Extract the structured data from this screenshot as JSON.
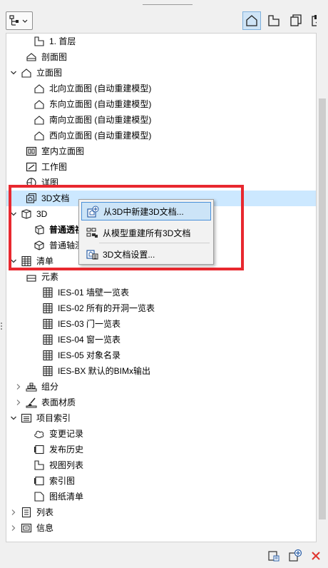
{
  "toolbar": {
    "left_icon": "project-map-icon",
    "view_icons": [
      "project-map-view-icon",
      "view-map-icon",
      "layout-book-icon",
      "publisher-sets-icon"
    ]
  },
  "tree": {
    "rows": [
      {
        "label": "1. 首层",
        "icon": "floor-plan-icon",
        "expander": "none"
      },
      {
        "label": "剖面图",
        "icon": "section-icon",
        "expander": "none"
      },
      {
        "label": "立面图",
        "icon": "elevation-icon",
        "expander": "expanded"
      },
      {
        "label": "北向立面图 (自动重建模型)",
        "icon": "elevation-icon",
        "expander": "none"
      },
      {
        "label": "东向立面图 (自动重建模型)",
        "icon": "elevation-icon",
        "expander": "none"
      },
      {
        "label": "南向立面图 (自动重建模型)",
        "icon": "elevation-icon",
        "expander": "none"
      },
      {
        "label": "西向立面图 (自动重建模型)",
        "icon": "elevation-icon",
        "expander": "none"
      },
      {
        "label": "室内立面图",
        "icon": "interior-elevation-icon",
        "expander": "none"
      },
      {
        "label": "工作图",
        "icon": "worksheet-icon",
        "expander": "none"
      },
      {
        "label": "详图",
        "icon": "detail-icon",
        "expander": "none"
      },
      {
        "label": "3D文档",
        "icon": "3d-document-icon",
        "expander": "none",
        "selected": true
      },
      {
        "label": "3D",
        "icon": "3d-cube-icon",
        "expander": "expanded"
      },
      {
        "label": "普通透视",
        "icon": "perspective-icon",
        "expander": "none",
        "bold": true
      },
      {
        "label": "普通轴测",
        "icon": "axonometry-icon",
        "expander": "none"
      },
      {
        "label": "清单",
        "icon": "schedule-grid-icon",
        "expander": "expanded"
      },
      {
        "label": "元素",
        "icon": "element-schedule-icon",
        "expander": "none"
      },
      {
        "label": "IES-01 墙壁一览表",
        "icon": "schedule-table-icon",
        "expander": "none"
      },
      {
        "label": "IES-02 所有的开洞一览表",
        "icon": "schedule-table-icon",
        "expander": "none"
      },
      {
        "label": "IES-03 门一览表",
        "icon": "schedule-table-icon",
        "expander": "none"
      },
      {
        "label": "IES-04 窗一览表",
        "icon": "schedule-table-icon",
        "expander": "none"
      },
      {
        "label": "IES-05 对象名录",
        "icon": "schedule-table-icon",
        "expander": "none"
      },
      {
        "label": "IES-BX 默认的BIMx输出",
        "icon": "schedule-table-icon",
        "expander": "none"
      },
      {
        "label": "组分",
        "icon": "components-icon",
        "expander": "collapsed"
      },
      {
        "label": "表面材质",
        "icon": "surfaces-icon",
        "expander": "collapsed"
      },
      {
        "label": "项目索引",
        "icon": "project-index-icon",
        "expander": "expanded"
      },
      {
        "label": "变更记录",
        "icon": "change-cloud-icon",
        "expander": "none"
      },
      {
        "label": "发布历史",
        "icon": "issue-history-icon",
        "expander": "none"
      },
      {
        "label": "视图列表",
        "icon": "view-list-icon",
        "expander": "none"
      },
      {
        "label": "索引图",
        "icon": "index-sheet-icon",
        "expander": "none"
      },
      {
        "label": "图纸清单",
        "icon": "drawing-list-icon",
        "expander": "none"
      },
      {
        "label": "列表",
        "icon": "list-icon",
        "expander": "collapsed"
      },
      {
        "label": "信息",
        "icon": "info-icon",
        "expander": "collapsed"
      }
    ]
  },
  "context_menu": {
    "items": [
      {
        "label": "从3D中新建3D文档...",
        "icon": "new-3d-document-icon",
        "hover": true
      },
      {
        "label": "从模型重建所有3D文档",
        "icon": "rebuild-all-icon"
      },
      {
        "label": "3D文档设置...",
        "icon": "3d-document-settings-icon"
      }
    ]
  },
  "footer": {
    "icons": [
      "settings-icon",
      "new-view-icon",
      "delete-icon"
    ]
  },
  "colors": {
    "highlight_border": "#e8282f",
    "selection": "#cce8ff",
    "menu_hover": "#cce4f7"
  }
}
